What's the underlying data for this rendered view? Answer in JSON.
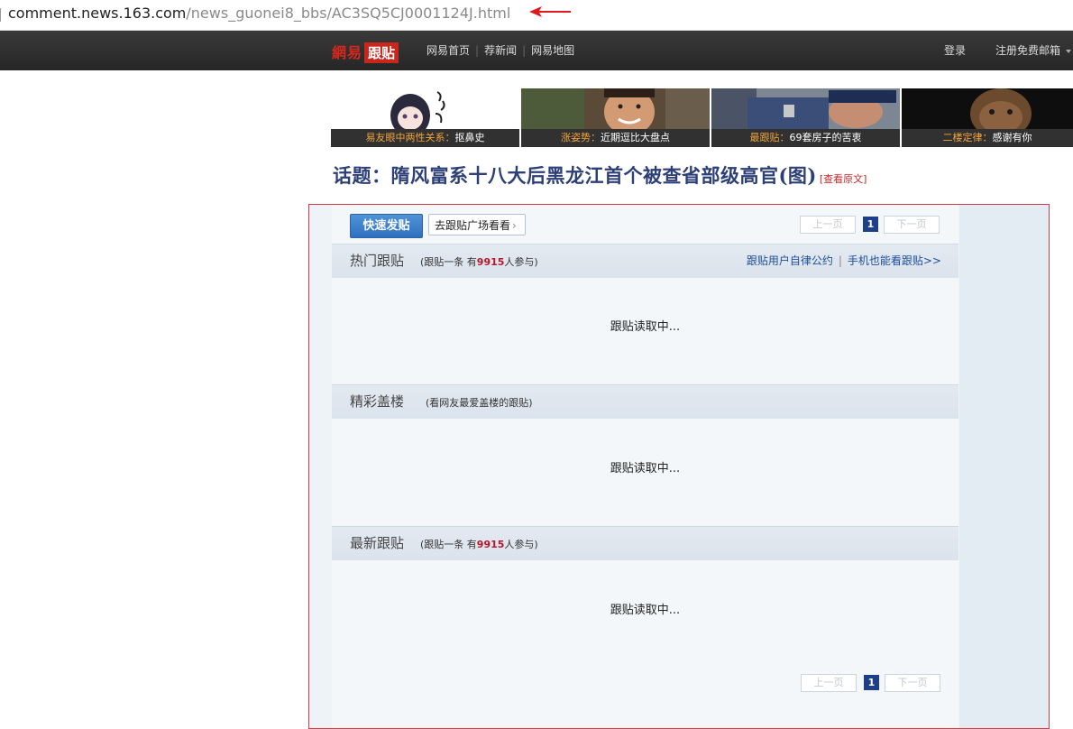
{
  "browser": {
    "url_host": "comment.news.163.com",
    "url_path": "/news_guonei8_bbs/AC3SQ5CJ0001124J.html"
  },
  "topnav": {
    "logo_part1": "網易",
    "logo_part2": "跟贴",
    "links": [
      "网易首页",
      "荐新闻",
      "网易地图"
    ],
    "login": "登录",
    "register": "注册免费邮箱"
  },
  "promos": [
    {
      "kicker": "易友眼中两性关系：",
      "text": "抠鼻史"
    },
    {
      "kicker": "涨姿势：",
      "text": "近期逗比大盘点"
    },
    {
      "kicker": "最跟贴：",
      "text": "69套房子的苦衷"
    },
    {
      "kicker": "二楼定律：",
      "text": "感谢有你"
    }
  ],
  "topic": {
    "title": "话题：隋风富系十八大后黑龙江首个被查省部级高官(图)",
    "view_original": "[查看原文]"
  },
  "toolbar": {
    "fast_post": "快速发贴",
    "square": "去跟贴广场看看",
    "prev": "上一页",
    "current_page": "1",
    "next": "下一页"
  },
  "sections": {
    "hot": {
      "title": "热门跟贴",
      "sub_prefix": "(跟贴一条  有",
      "count": "9915",
      "sub_suffix": "人参与)",
      "link1": "跟贴用户自律公约",
      "link2": "手机也能看跟贴>>",
      "loading": "跟贴读取中..."
    },
    "building": {
      "title": "精彩盖楼",
      "sub": "(看网友最爱盖楼的跟贴)",
      "loading": "跟贴读取中..."
    },
    "latest": {
      "title": "最新跟贴",
      "sub_prefix": "(跟贴一条  有",
      "count": "9915",
      "sub_suffix": "人参与)",
      "loading": "跟贴读取中..."
    }
  },
  "colors": {
    "nav_bg": "#2e2e2e",
    "brand_red": "#c9261d",
    "title_blue": "#2d3f77",
    "frame_red": "#d23c49",
    "accent_blue": "#2f70be",
    "page_current": "#1d3f8a"
  }
}
